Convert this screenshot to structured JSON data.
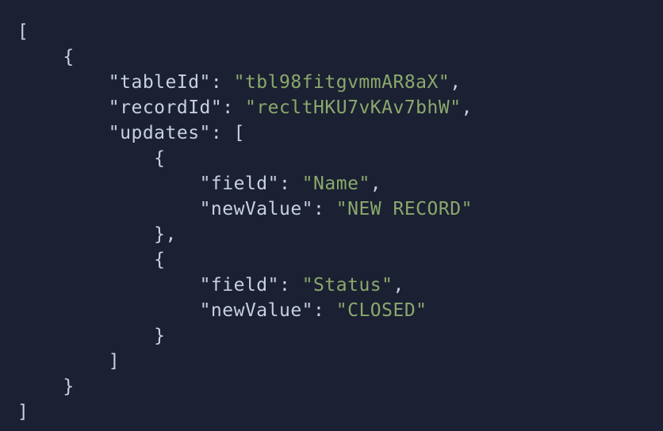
{
  "tokens": [
    [
      {
        "t": "[",
        "c": "p"
      }
    ],
    [
      {
        "t": "    ",
        "c": "p"
      },
      {
        "t": "{",
        "c": "p"
      }
    ],
    [
      {
        "t": "        ",
        "c": "p"
      },
      {
        "t": "\"tableId\"",
        "c": "k"
      },
      {
        "t": ": ",
        "c": "p"
      },
      {
        "t": "\"tbl98fitgvmmAR8aX\"",
        "c": "s"
      },
      {
        "t": ",",
        "c": "p"
      }
    ],
    [
      {
        "t": "        ",
        "c": "p"
      },
      {
        "t": "\"recordId\"",
        "c": "k"
      },
      {
        "t": ": ",
        "c": "p"
      },
      {
        "t": "\"recltHKU7vKAv7bhW\"",
        "c": "s"
      },
      {
        "t": ",",
        "c": "p"
      }
    ],
    [
      {
        "t": "        ",
        "c": "p"
      },
      {
        "t": "\"updates\"",
        "c": "k"
      },
      {
        "t": ": [",
        "c": "p"
      }
    ],
    [
      {
        "t": "            ",
        "c": "p"
      },
      {
        "t": "{",
        "c": "p"
      }
    ],
    [
      {
        "t": "                ",
        "c": "p"
      },
      {
        "t": "\"field\"",
        "c": "k"
      },
      {
        "t": ": ",
        "c": "p"
      },
      {
        "t": "\"Name\"",
        "c": "s"
      },
      {
        "t": ",",
        "c": "p"
      }
    ],
    [
      {
        "t": "                ",
        "c": "p"
      },
      {
        "t": "\"newValue\"",
        "c": "k"
      },
      {
        "t": ": ",
        "c": "p"
      },
      {
        "t": "\"NEW RECORD\"",
        "c": "s"
      }
    ],
    [
      {
        "t": "            ",
        "c": "p"
      },
      {
        "t": "},",
        "c": "p"
      }
    ],
    [
      {
        "t": "            ",
        "c": "p"
      },
      {
        "t": "{",
        "c": "p"
      }
    ],
    [
      {
        "t": "                ",
        "c": "p"
      },
      {
        "t": "\"field\"",
        "c": "k"
      },
      {
        "t": ": ",
        "c": "p"
      },
      {
        "t": "\"Status\"",
        "c": "s"
      },
      {
        "t": ",",
        "c": "p"
      }
    ],
    [
      {
        "t": "                ",
        "c": "p"
      },
      {
        "t": "\"newValue\"",
        "c": "k"
      },
      {
        "t": ": ",
        "c": "p"
      },
      {
        "t": "\"CLOSED\"",
        "c": "s"
      }
    ],
    [
      {
        "t": "            ",
        "c": "p"
      },
      {
        "t": "}",
        "c": "p"
      }
    ],
    [
      {
        "t": "        ",
        "c": "p"
      },
      {
        "t": "]",
        "c": "p"
      }
    ],
    [
      {
        "t": "    ",
        "c": "p"
      },
      {
        "t": "}",
        "c": "p"
      }
    ],
    [
      {
        "t": "]",
        "c": "p"
      }
    ]
  ]
}
